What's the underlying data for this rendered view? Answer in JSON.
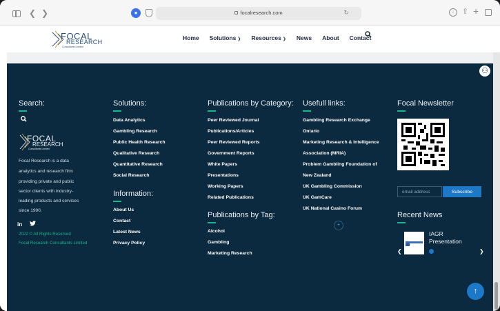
{
  "browser": {
    "url": "focalresearch.com"
  },
  "header": {
    "logo_line1": "FOCAL",
    "logo_line2": "RESEARCH",
    "logo_sub": "Consultants Limited",
    "nav": {
      "home": "Home",
      "solutions": "Solutions",
      "resources": "Resources",
      "news": "News",
      "about": "About",
      "contact": "Contact"
    }
  },
  "footer": {
    "search": {
      "title": "Search:",
      "logo_line1": "FOCAL",
      "logo_line2": "RESEARCH",
      "logo_sub": "Consultants Limited",
      "about": [
        "Focal Research is a data",
        "analytics and research firm",
        "providing private and public",
        "sector clients with industry-",
        "leading products and services",
        "since 1990."
      ],
      "social": {
        "linkedin": "in"
      },
      "copyright": "2022 © All Rights Reserved",
      "company": "Focal Research Consultants Limited"
    },
    "solutions": {
      "title": "Solutions:",
      "items": [
        "Data Analytics",
        "Gambling Research",
        "Public Health Research",
        "Qualitative Research",
        "Quantitative Research",
        "Social Research"
      ]
    },
    "information": {
      "title": "Information:",
      "items": [
        "About Us",
        "Contact",
        "Latest News",
        "Privacy Policy"
      ]
    },
    "publications_category": {
      "title": "Publications by Category:",
      "items": [
        "Peer Reviewed Journal",
        "Publications/Articles",
        "Peer Reviewed Reports",
        "Government Reports",
        "White Papers",
        "Presentations",
        "Working Papers",
        "Related Publications"
      ]
    },
    "publications_tag": {
      "title": "Publications by Tag:",
      "items": [
        "Alcohol",
        "Gambling",
        "Marketing Research"
      ]
    },
    "useful_links": {
      "title": "Usefull links:",
      "items": [
        "Gambling Research Exchange",
        "Ontario",
        "Marketing Research & Intelligence",
        "Association (MRIA)",
        "Problem Gambling Foundation of",
        "New Zealand",
        "UK Gambling Commission",
        "UK GamCare",
        "UK National Casino Forum"
      ],
      "pager": "+"
    },
    "newsletter": {
      "title": "Focal Newsletter",
      "email_placeholder": "email address",
      "subscribe_label": "Subscribe"
    },
    "recent_news": {
      "title": "Recent News",
      "item_title_line1": "IAGR",
      "item_title_line2": "Presentation"
    }
  },
  "colors": {
    "footer_bg": "#0b2a3f",
    "accent_green": "#17b890",
    "accent_blue": "#1e78c8"
  }
}
